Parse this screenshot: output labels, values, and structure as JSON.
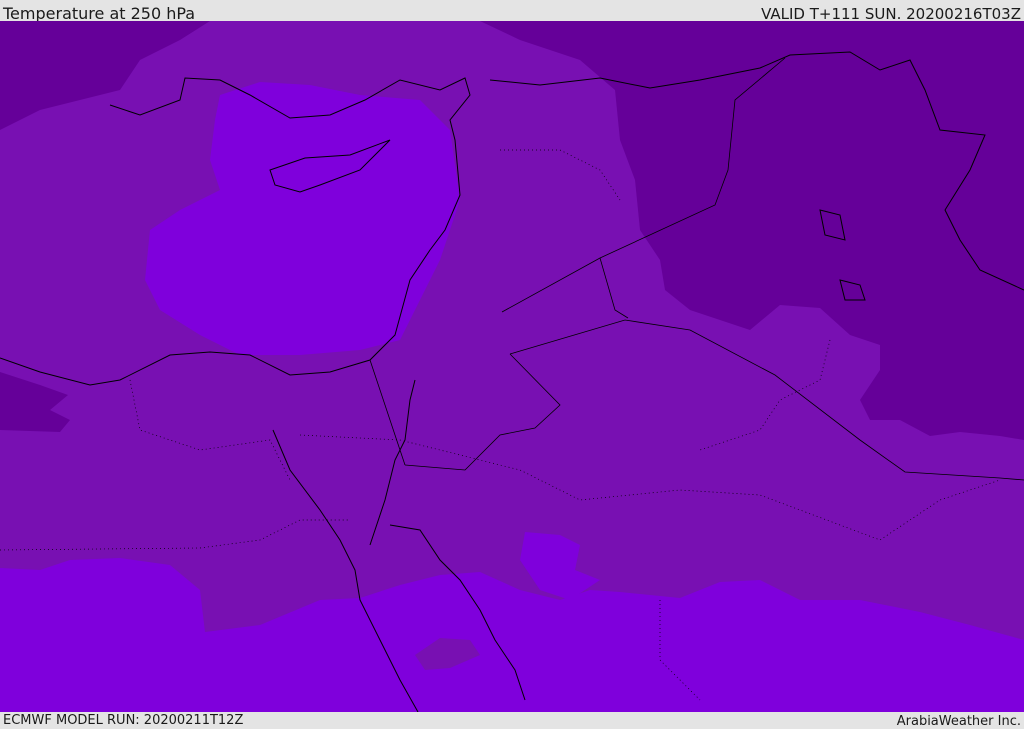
{
  "header": {
    "title": "Temperature at 250 hPa",
    "valid": "VALID T+111 SUN. 20200216T03Z"
  },
  "footer": {
    "model_run": "ECMWF MODEL RUN: 20200211T12Z",
    "brand": "ArabiaWeather Inc."
  },
  "colors": {
    "cold": "#650099",
    "mid": "#7810b2",
    "warm": "#7f00dc",
    "coast": "#000000"
  }
}
